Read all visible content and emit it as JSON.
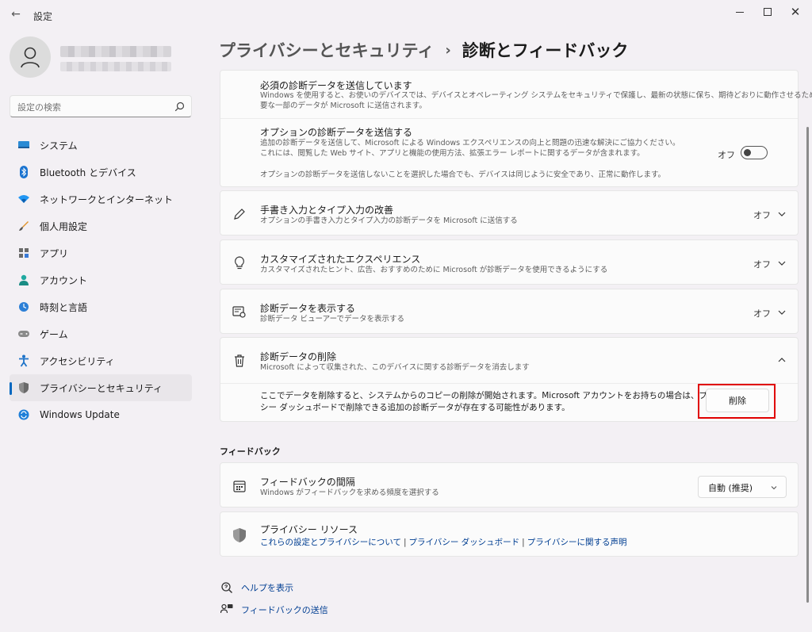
{
  "window": {
    "title": "設定"
  },
  "search": {
    "placeholder": "設定の検索"
  },
  "sidebar": {
    "items": [
      {
        "label": "システム"
      },
      {
        "label": "Bluetooth とデバイス"
      },
      {
        "label": "ネットワークとインターネット"
      },
      {
        "label": "個人用設定"
      },
      {
        "label": "アプリ"
      },
      {
        "label": "アカウント"
      },
      {
        "label": "時刻と言語"
      },
      {
        "label": "ゲーム"
      },
      {
        "label": "アクセシビリティ"
      },
      {
        "label": "プライバシーとセキュリティ"
      },
      {
        "label": "Windows Update"
      }
    ]
  },
  "breadcrumb": {
    "parent": "プライバシーとセキュリティ",
    "separator": "›",
    "current": "診断とフィードバック"
  },
  "required": {
    "title": "必須の診断データを送信しています",
    "desc1": "Windows を使用すると、お使いのデバイスでは、デバイスとオペレーティング システムをセキュリティで保護し、最新の状態に保ち、期待どおりに動作させるために必",
    "desc2": "要な一部のデータが Microsoft に送信されます。"
  },
  "optional": {
    "title": "オプションの診断データを送信する",
    "desc1": "追加の診断データを送信して、Microsoft による Windows エクスペリエンスの向上と問題の迅速な解決にご協力ください。",
    "desc2": "これには、閲覧した Web サイト、アプリと機能の使用方法、拡張エラー レポートに関するデータが含まれます。",
    "note": "オプションの診断データを送信しないことを選択した場合でも、デバイスは同じように安全であり、正常に動作します。",
    "state": "オフ"
  },
  "inking": {
    "title": "手書き入力とタイプ入力の改善",
    "desc": "オプションの手書き入力とタイプ入力の診断データを Microsoft に送信する",
    "state": "オフ"
  },
  "tailored": {
    "title": "カスタマイズされたエクスペリエンス",
    "desc": "カスタマイズされたヒント、広告、おすすめのために Microsoft が診断データを使用できるようにする",
    "state": "オフ"
  },
  "viewdata": {
    "title": "診断データを表示する",
    "desc": "診断データ ビューアーでデータを表示する",
    "state": "オフ"
  },
  "deletedata": {
    "title": "診断データの削除",
    "desc": "Microsoft によって収集された、このデバイスに関する診断データを消去します",
    "body1": "ここでデータを削除すると、システムからのコピーの削除が開始されます。Microsoft アカウントをお持ちの場合は、プライバ",
    "body2": "シー ダッシュボードで削除できる追加の診断データが存在する可能性があります。",
    "button": "削除"
  },
  "feedback_section": {
    "title": "フィードバック"
  },
  "frequency": {
    "title": "フィードバックの間隔",
    "desc": "Windows がフィードバックを求める頻度を選択する",
    "value": "自動 (推奨)"
  },
  "privacy_resources": {
    "title": "プライバシー リソース",
    "link1": "これらの設定とプライバシーについて",
    "link2": "プライバシー ダッシュボード",
    "link3": "プライバシーに関する声明",
    "sep": "|"
  },
  "help": {
    "get_help": "ヘルプを表示",
    "give_feedback": "フィードバックの送信"
  },
  "colors": {
    "accent": "#0067c0",
    "link": "#003e92",
    "highlight": "#e00000"
  }
}
